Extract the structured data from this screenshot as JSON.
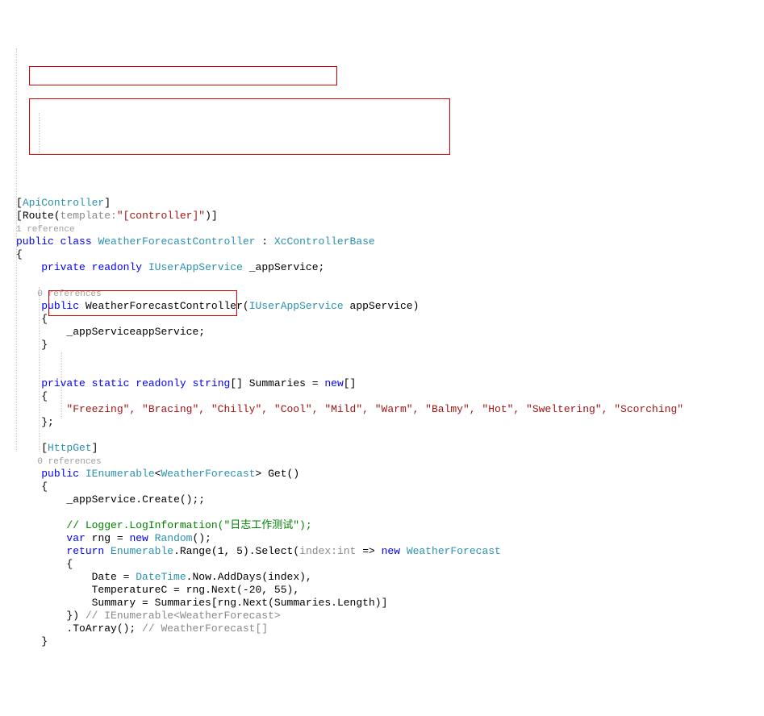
{
  "attributes": {
    "api": "ApiController",
    "route_text": "Route",
    "route_hint": "template:",
    "route_value": "\"[controller]\"",
    "httpget": "HttpGet"
  },
  "refs": {
    "one": "1 reference",
    "zero": "0 references"
  },
  "decl": {
    "public": "public",
    "class": "class",
    "private": "private",
    "readonly": "readonly",
    "static": "static",
    "new": "new",
    "return": "return",
    "var": "var",
    "className": "WeatherForecastController",
    "base": "XcControllerBase",
    "serviceInterface": "IUserAppService",
    "serviceField": "_appService",
    "ctorParam": "appService",
    "summariesName": "Summaries",
    "summariesType": "string",
    "ienum": "IEnumerable",
    "retType": "WeatherForecast",
    "getName": "Get",
    "enumerable": "Enumerable",
    "range": "Range",
    "select": "Select",
    "indexHint": "index",
    "intHint": ":int",
    "lambdaArrow": "=>",
    "dateProp": "Date",
    "datetime": "DateTime",
    "now": "Now",
    "adddays": "AddDays",
    "tempProp": "TemperatureC",
    "rngNext": "Next",
    "summaryProp": "Summary",
    "length": "Length",
    "toarray": "ToArray",
    "random": "Random",
    "rng": "rng",
    "create": "Create"
  },
  "summaries": [
    "\"Freezing\"",
    "\"Bracing\"",
    "\"Chilly\"",
    "\"Cool\"",
    "\"Mild\"",
    "\"Warm\"",
    "\"Balmy\"",
    "\"Hot\"",
    "\"Sweltering\"",
    "\"Scorching\""
  ],
  "commentLog": "// Logger.LogInformation(\"日志工作测试\");",
  "inlineComment1": "// IEnumerable<WeatherForecast>",
  "inlineComment2": "// WeatherForecast[]",
  "rangeArgs": "(1, 5)",
  "nextArgs": "(-20, 55)",
  "assign": " = "
}
